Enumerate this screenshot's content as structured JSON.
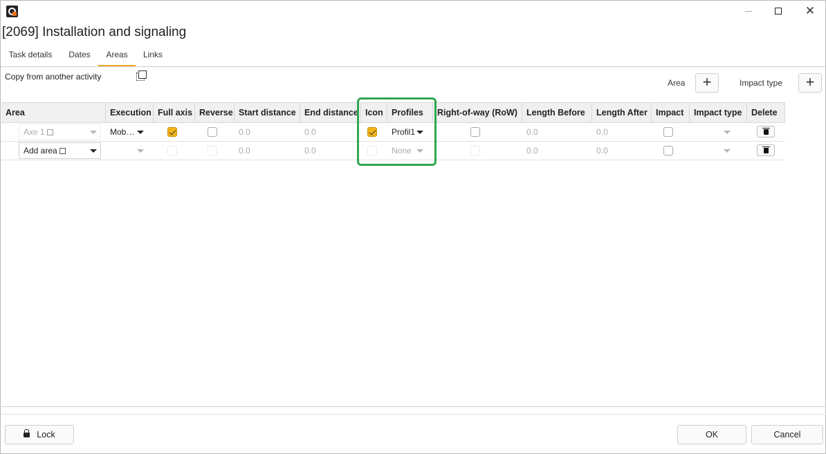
{
  "window": {
    "heading": "[2069]  Installation and signaling"
  },
  "tabs": [
    {
      "label": "Task details",
      "active": false
    },
    {
      "label": "Dates",
      "active": false
    },
    {
      "label": "Areas",
      "active": true
    },
    {
      "label": "Links",
      "active": false
    }
  ],
  "toolbar": {
    "copy_label": "Copy from another activity",
    "area_label": "Area",
    "area_add": "+",
    "impact_type_label": "Impact type",
    "impact_type_add": "+"
  },
  "table": {
    "columns": [
      "Area",
      "Execution",
      "Full axis",
      "Reverse",
      "Start distance",
      "End distance",
      "Icon",
      "Profiles",
      "Right-of-way (RoW)",
      "Length Before",
      "Length After",
      "Impact",
      "Impact type",
      "Delete"
    ],
    "rows": [
      {
        "area": "Axe 1",
        "execution": "Mob…",
        "full_axis": true,
        "reverse": false,
        "start_distance": "0.0",
        "end_distance": "0.0",
        "icon": true,
        "profiles": "Profil1",
        "row": false,
        "length_before": "0.0",
        "length_after": "0.0",
        "impact": false
      },
      {
        "area": "Add area",
        "execution": "",
        "full_axis": false,
        "reverse": false,
        "start_distance": "0.0",
        "end_distance": "0.0",
        "icon": false,
        "profiles": "None",
        "row": false,
        "length_before": "0.0",
        "length_after": "0.0",
        "impact": false
      }
    ]
  },
  "footer": {
    "lock_label": "Lock",
    "ok_label": "OK",
    "cancel_label": "Cancel"
  },
  "colors": {
    "accent": "#f1a820",
    "checkbox_checked": "#f3b41a",
    "highlight": "#2fa84f"
  }
}
